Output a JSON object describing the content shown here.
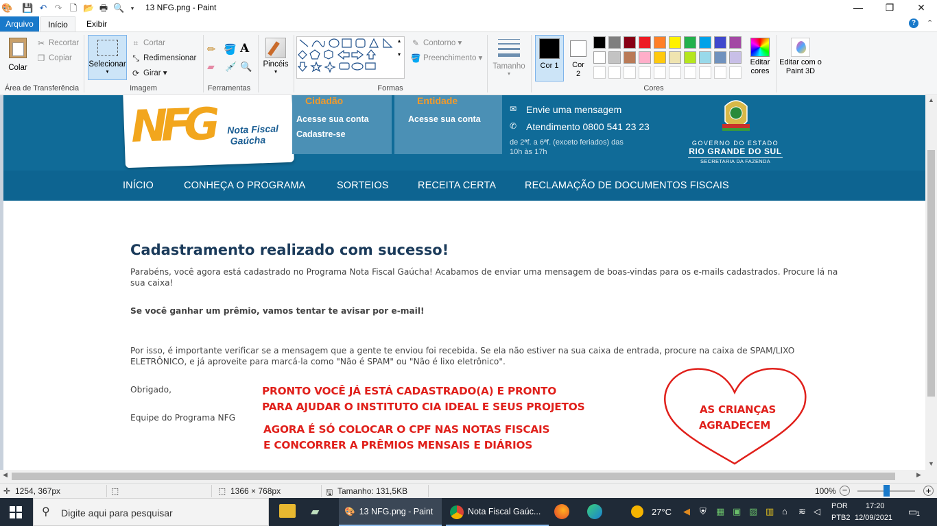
{
  "title_bar": {
    "title": "13 NFG.png - Paint",
    "minimize": "—",
    "maximize": "❐",
    "close": "✕"
  },
  "tabs": {
    "arquivo": "Arquivo",
    "inicio": "Início",
    "exibir": "Exibir"
  },
  "ribbon": {
    "clipboard": {
      "colar": "Colar",
      "recortar": "Recortar",
      "copiar": "Copiar",
      "group": "Área de Transferência"
    },
    "image": {
      "selecionar": "Selecionar",
      "cortar": "Cortar",
      "redimensionar": "Redimensionar",
      "girar": "Girar",
      "group": "Imagem"
    },
    "tools": {
      "group": "Ferramentas"
    },
    "brushes": {
      "label": "Pincéis"
    },
    "shapes": {
      "contorno": "Contorno",
      "preenchimento": "Preenchimento",
      "group": "Formas"
    },
    "size": {
      "label": "Tamanho"
    },
    "colors": {
      "cor1": "Cor 1",
      "cor2": "Cor 2",
      "editar": "Editar cores",
      "group": "Cores",
      "palette_row1": [
        "#000000",
        "#7f7f7f",
        "#880015",
        "#ed1c24",
        "#ff7f27",
        "#fff200",
        "#22b14c",
        "#00a2e8",
        "#3f48cc",
        "#a349a4"
      ],
      "palette_row2": [
        "#ffffff",
        "#c3c3c3",
        "#b97a57",
        "#ffaec9",
        "#ffc90e",
        "#efe4b0",
        "#b5e61d",
        "#99d9ea",
        "#7092be",
        "#c8bfe7"
      ]
    },
    "paint3d": "Editar com o Paint 3D"
  },
  "site": {
    "cidadao": {
      "title": "Cidadão",
      "link1": "Acesse sua conta",
      "link2": "Cadastre-se"
    },
    "entidade": {
      "title": "Entidade",
      "link1": "Acesse sua conta"
    },
    "contact": {
      "mensagem": "Envie uma mensagem",
      "atendimento": "Atendimento 0800 541 23 23",
      "horario1": "de 2ªf. a 6ªf. (exceto feriados) das",
      "horario2": "10h às 17h"
    },
    "gov": {
      "line1": "GOVERNO DO ESTADO",
      "line2": "RIO GRANDE DO SUL",
      "line3": "SECRETARIA DA FAZENDA"
    },
    "logo": {
      "nfg": "NFG",
      "line1": "Nota Fiscal",
      "line2": "Gaúcha"
    },
    "nav": [
      "INÍCIO",
      "CONHEÇA O PROGRAMA",
      "SORTEIOS",
      "RECEITA CERTA",
      "RECLAMAÇÃO DE DOCUMENTOS FISCAIS"
    ],
    "heading": "Cadastramento realizado com sucesso!",
    "p1a": "Parabéns, você agora está cadastrado no Programa Nota Fiscal Gaúcha! Acabamos de enviar uma mensagem de boas-vindas para os e-mails cadastrados. Procure lá na",
    "p1b": "sua caixa!",
    "p2": "Se você ganhar um prêmio, vamos tentar te avisar por e-mail!",
    "p3a": "Por isso, é importante verificar se a mensagem que a gente te enviou foi recebida. Se ela não estiver na sua caixa de entrada, procure na caixa de SPAM/LIXO",
    "p3b": "ELETRÔNICO, e já aproveite para marcá-la como \"Não é SPAM\" ou \"Não é lixo eletrônico\".",
    "obrigado": "Obrigado,",
    "equipe": "Equipe do Programa NFG"
  },
  "annotations": {
    "red1": "PRONTO VOCÊ JÁ ESTÁ CADASTRADO(A) E PRONTO",
    "red2": "PARA AJUDAR O INSTITUTO CIA IDEAL E SEUS PROJETOS",
    "red3": "AGORA É SÓ COLOCAR O CPF NAS NOTAS FISCAIS",
    "red4": "E CONCORRER A PRÊMIOS MENSAIS E DIÁRIOS",
    "heart1": "AS CRIANÇAS",
    "heart2": "AGRADECEM"
  },
  "status": {
    "cursor": "1254, 367px",
    "dims": "1366 × 768px",
    "size": "Tamanho: 131,5KB",
    "zoom": "100%"
  },
  "taskbar": {
    "search_placeholder": "Digite aqui para pesquisar",
    "app1": "13 NFG.png - Paint",
    "app2": "Nota Fiscal Gaúc...",
    "temp": "27°C",
    "lang1": "POR",
    "lang2": "PTB2",
    "time": "17:20",
    "date": "12/09/2021",
    "notif": "1"
  }
}
